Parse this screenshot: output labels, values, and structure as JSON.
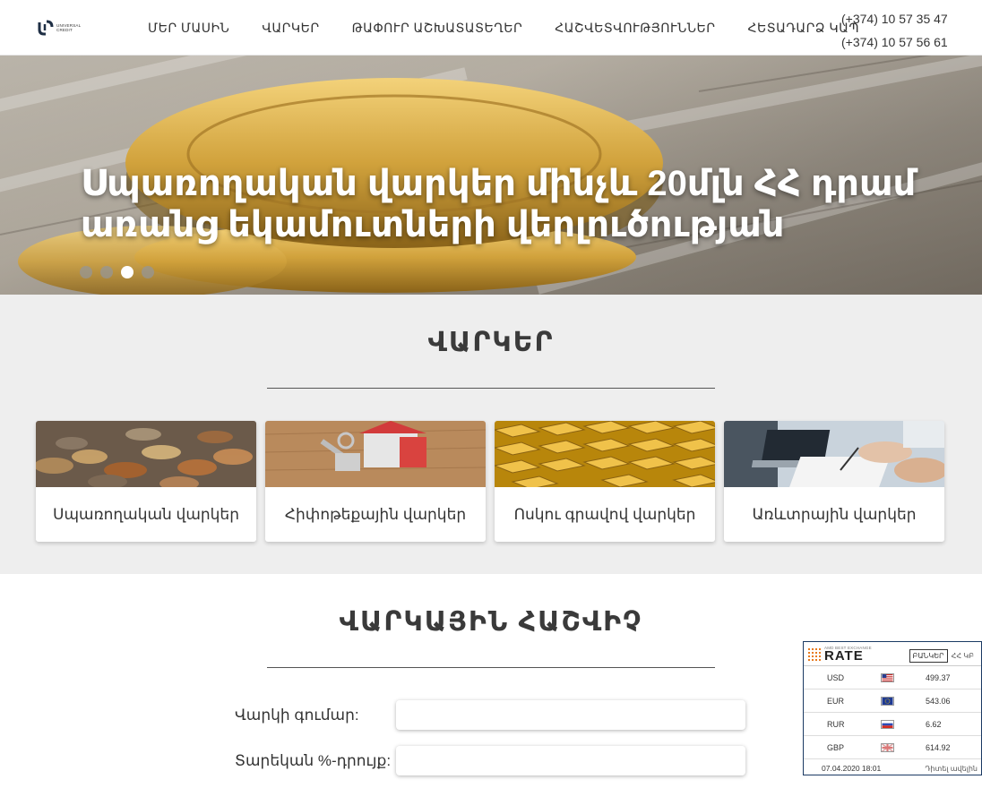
{
  "header": {
    "logo": {
      "text_line1": "UNIVERSAL",
      "text_line2": "CREDIT"
    },
    "nav": [
      {
        "label": "ՄԵՐ ՄԱՍԻՆ"
      },
      {
        "label": "ՎԱՐԿԵՐ"
      },
      {
        "label": "ԹԱՓՈՒՐ ԱՇԽԱՏԱՏԵՂԵՐ"
      },
      {
        "label": "ՀԱՇՎԵՏՎՈՒԹՅՈՒՆՆԵՐ"
      },
      {
        "label": "ՀԵՏԱԴԱՐՁ ԿԱՊ"
      }
    ],
    "phones": [
      "(+374) 10 57 35 47",
      "(+374) 10 57 56 61"
    ]
  },
  "hero": {
    "title": "Սպառողական վարկեր մինչև 20մլն ՀՀ դրամ առանց եկամուտների վերլուծության",
    "active_slide": 3,
    "slide_count": 4
  },
  "loans_section": {
    "title": "ՎԱՐԿԵՐ",
    "cards": [
      {
        "label": "Սպառողական վարկեր",
        "image": "coins-photo"
      },
      {
        "label": "Հիփոթեքային վարկեր",
        "image": "house-keys-photo"
      },
      {
        "label": "Ոսկու գրավով վարկեր",
        "image": "gold-bars-photo"
      },
      {
        "label": "Առևտրային վարկեր",
        "image": "business-desk-photo"
      }
    ]
  },
  "calculator": {
    "title": "ՎԱՐԿԱՅԻՆ ՀԱՇՎԻՉ",
    "fields": [
      {
        "label": "Վարկի գումար:",
        "value": ""
      },
      {
        "label": "Տարեկան %-դրույք:",
        "value": ""
      }
    ]
  },
  "rate_widget": {
    "brand_sub": "AMD BEST EXCHANGE",
    "brand": "RATE",
    "tabs": [
      {
        "label": "ԲԱՆԿԵՐ",
        "active": true
      },
      {
        "label": "ՀՀ ԿԲ",
        "active": false
      }
    ],
    "rows": [
      {
        "currency": "USD",
        "value": "499.37",
        "flag": "us-flag-icon"
      },
      {
        "currency": "EUR",
        "value": "543.06",
        "flag": "eu-flag-icon"
      },
      {
        "currency": "RUR",
        "value": "6.62",
        "flag": "ru-flag-icon"
      },
      {
        "currency": "GBP",
        "value": "614.92",
        "flag": "gb-flag-icon"
      }
    ],
    "date": "07.04.2020 18:01",
    "more_link": "Դիտել ավելին"
  },
  "colors": {
    "accent_orange": "#e87a1d",
    "section_bg": "#eeeeee",
    "title_text": "#3a3a3a"
  }
}
